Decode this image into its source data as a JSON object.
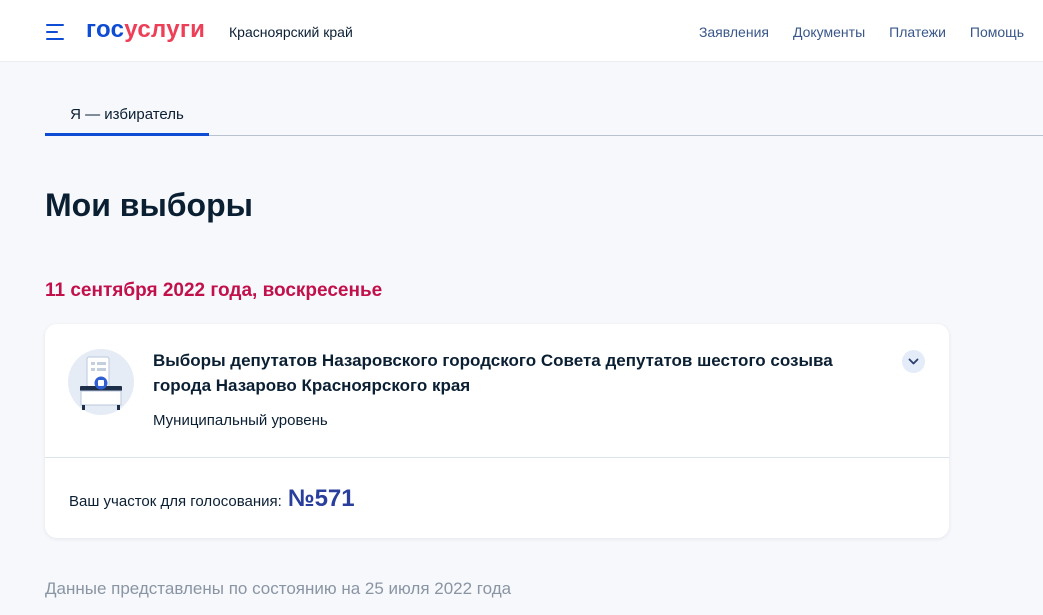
{
  "header": {
    "logo_part1": "гос",
    "logo_part2": "услуги",
    "region": "Красноярский край",
    "nav": [
      "Заявления",
      "Документы",
      "Платежи",
      "Помощь"
    ]
  },
  "tabs": [
    {
      "label": "Я — избиратель",
      "active": true
    }
  ],
  "page_title": "Мои выборы",
  "date_heading": "11 сентября 2022 года, воскресенье",
  "election_card": {
    "icon": "ballot-box-icon",
    "title": "Выборы депутатов Назаровского городского Совета депутатов шестого созыва города Назарово Красноярского края",
    "level": "Муниципальный уровень",
    "precinct_label": "Ваш участок для голосования:",
    "precinct_number": "№571"
  },
  "footnote": "Данные представлены по состоянию на 25 июля 2022 года",
  "colors": {
    "brand_blue": "#0d4cd3",
    "brand_red": "#ee3f58",
    "date_red": "#c2104a",
    "nav_link": "#3a5789",
    "precinct_blue": "#2a3f9c",
    "background": "#f6f8fc"
  }
}
